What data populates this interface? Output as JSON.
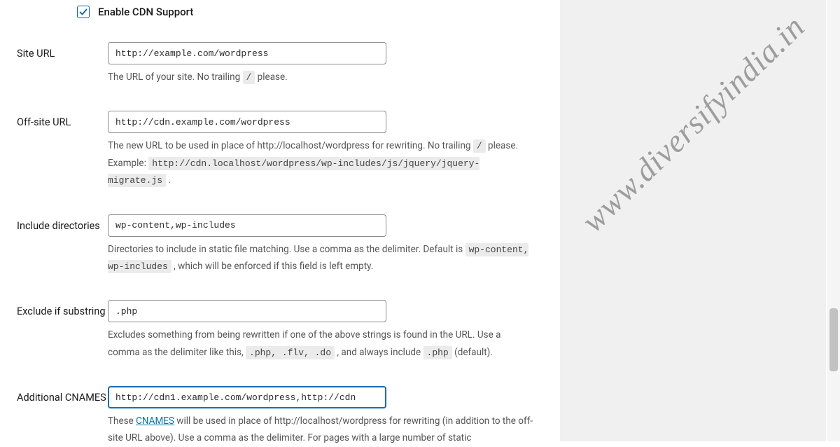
{
  "enable": {
    "label": "Enable CDN Support",
    "checked": true
  },
  "site_url": {
    "label": "Site URL",
    "value": "http://example.com/wordpress",
    "help_prefix": "The URL of your site. No trailing ",
    "help_code": "/",
    "help_suffix": " please."
  },
  "offsite_url": {
    "label": "Off-site URL",
    "value": "http://cdn.example.com/wordpress",
    "help_prefix": "The new URL to be used in place of http://localhost/wordpress for rewriting. No trailing ",
    "help_code": "/",
    "help_suffix": " please.",
    "example_label": "Example: ",
    "example_code": "http://cdn.localhost/wordpress/wp-includes/js/jquery/jquery-migrate.js",
    "example_suffix": " ."
  },
  "include_dirs": {
    "label": "Include directories",
    "value": "wp-content,wp-includes",
    "help_prefix": "Directories to include in static file matching. Use a comma as the delimiter. Default is ",
    "help_code": "wp-content, wp-includes",
    "help_suffix": " , which will be enforced if this field is left empty."
  },
  "exclude": {
    "label": "Exclude if substring",
    "value": ".php",
    "help_prefix": "Excludes something from being rewritten if one of the above strings is found in the URL. Use a comma as the delimiter like this, ",
    "help_code1": ".php, .flv, .do",
    "help_mid": " , and always include ",
    "help_code2": ".php",
    "help_suffix": " (default)."
  },
  "cnames": {
    "label": "Additional CNAMES",
    "value": "http://cdn1.example.com/wordpress,http://cdn",
    "help_prefix": "These ",
    "help_link": "CNAMES",
    "help_after_link": " will be used in place of http://localhost/wordpress for rewriting (in addition to the off-site URL above). Use a comma as the delimiter. For pages with a large number of static"
  },
  "watermark": "www.diversifyindia.in"
}
